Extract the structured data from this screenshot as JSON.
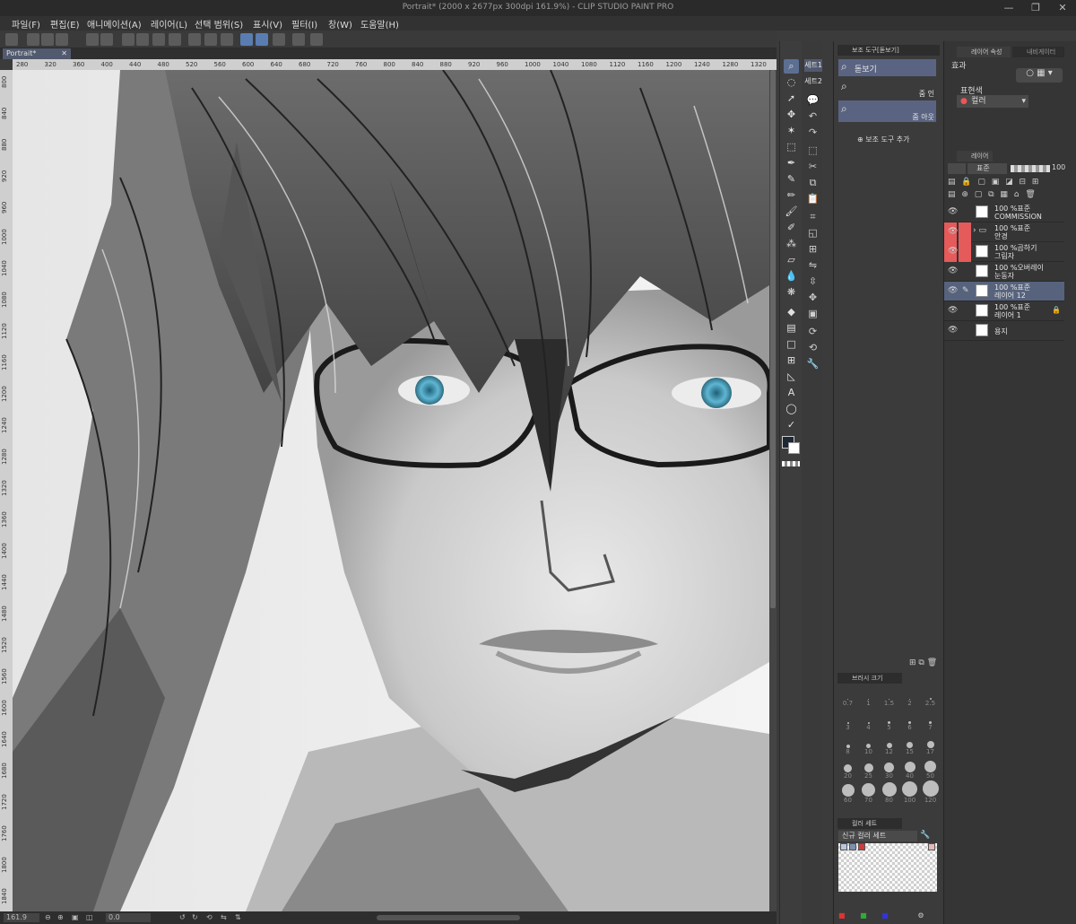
{
  "window": {
    "title": "Portrait* (2000 x 2677px 300dpi 161.9%) - CLIP STUDIO PAINT PRO",
    "minimize": "—",
    "maximize": "❐",
    "close": "✕"
  },
  "menu": [
    "파일(F)",
    "편집(E)",
    "애니메이션(A)",
    "레이어(L)",
    "선택 범위(S)",
    "표시(V)",
    "필터(I)",
    "창(W)",
    "도움말(H)"
  ],
  "doc_tab": {
    "label": "Portrait*",
    "close": "✕"
  },
  "ruler": {
    "h_ticks": [
      "280",
      "320",
      "360",
      "400",
      "440",
      "480",
      "520",
      "560",
      "600",
      "640",
      "680",
      "720",
      "760",
      "800",
      "840",
      "880",
      "920",
      "960",
      "1000",
      "1040",
      "1080",
      "1120",
      "1160",
      "1200",
      "1240",
      "1280",
      "1320"
    ],
    "v_ticks": [
      "800",
      "840",
      "880",
      "920",
      "960",
      "1000",
      "1040",
      "1080",
      "1120",
      "1160",
      "1200",
      "1240",
      "1280",
      "1320",
      "1360",
      "1400",
      "1440",
      "1480",
      "1520",
      "1560",
      "1600",
      "1640",
      "1680",
      "1720",
      "1760",
      "1800",
      "1840"
    ]
  },
  "status": {
    "zoom": "161.9",
    "angle": "0.0"
  },
  "set_tabs": [
    "세트1",
    "세트2"
  ],
  "sub_tool_panel": {
    "tab_label": "보조 도구[돋보기]",
    "items": [
      {
        "label": "돋보기",
        "secondary": ""
      },
      {
        "label": "",
        "secondary": "줌 인"
      },
      {
        "label": "",
        "secondary": "줌 아웃"
      }
    ],
    "add_label": "보조 도구 추가"
  },
  "brush_size": {
    "tab_label": "브러시 크기",
    "sizes": [
      "0.7",
      "1",
      "1.5",
      "2",
      "2.5",
      "3",
      "4",
      "5",
      "6",
      "7",
      "8",
      "10",
      "12",
      "15",
      "17",
      "20",
      "25",
      "30",
      "40",
      "50",
      "60",
      "70",
      "80",
      "100",
      "120"
    ]
  },
  "color_set": {
    "tab_label": "컬러 세트",
    "set_name": "신규 컬러 세트"
  },
  "layer_property": {
    "tab_label": "레이어 속성",
    "tab2_label": "내비게이터",
    "effect_label": "효과",
    "expression_label": "표현색",
    "expression_value": "컬러"
  },
  "layer_panel": {
    "tab_label": "레이어",
    "blend_mode": "표준",
    "opacity": "100",
    "layers": [
      {
        "line1": "100 %표준",
        "line2": "COMMISSION",
        "red": false,
        "folder": false,
        "selected": false,
        "lock": false
      },
      {
        "line1": "100 %표준",
        "line2": "안경",
        "red": true,
        "folder": true,
        "selected": false,
        "lock": false
      },
      {
        "line1": "100 %곱하기",
        "line2": "그림자",
        "red": true,
        "folder": false,
        "selected": false,
        "lock": false
      },
      {
        "line1": "100 %오버레이",
        "line2": "눈동자",
        "red": false,
        "folder": false,
        "selected": false,
        "lock": false
      },
      {
        "line1": "100 %표준",
        "line2": "레이어 12",
        "red": false,
        "folder": false,
        "selected": true,
        "lock": false
      },
      {
        "line1": "100 %표준",
        "line2": "레이어 1",
        "red": false,
        "folder": false,
        "selected": false,
        "lock": true
      },
      {
        "line1": "",
        "line2": "용지",
        "red": false,
        "folder": false,
        "selected": false,
        "lock": false
      }
    ]
  },
  "colors": {
    "accent": "#5a6482",
    "selected_tool": "#5c6f93",
    "red_marker": "#e55a5a",
    "eye": "#5fb6d3"
  }
}
